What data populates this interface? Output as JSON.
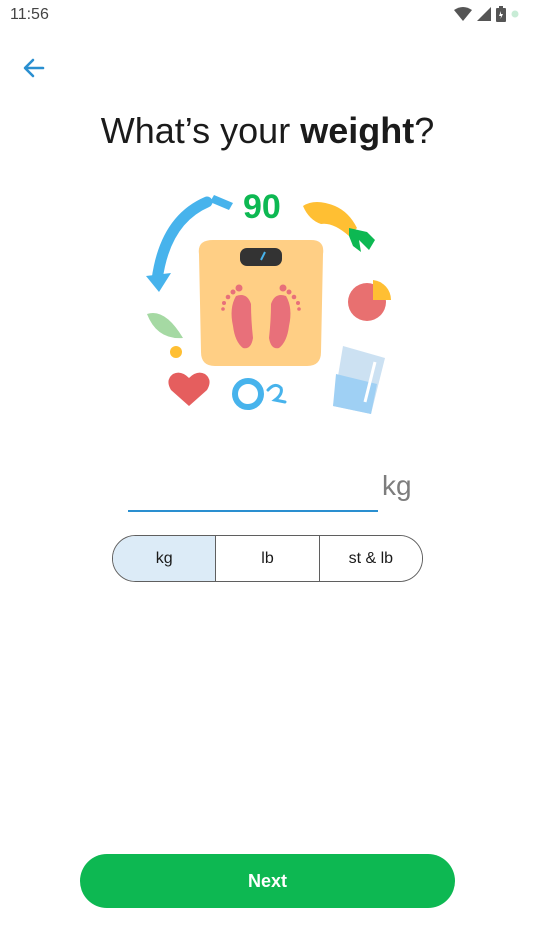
{
  "status_bar": {
    "time": "11:56",
    "icons": [
      "wifi-icon",
      "signal-icon",
      "battery-icon",
      "notification-dot-icon"
    ]
  },
  "header": {
    "back_icon": "arrow-left-icon",
    "accent_color": "#2a8fd0"
  },
  "title": {
    "prefix": "What’s your ",
    "bold": "weight",
    "suffix": "?"
  },
  "illustration": {
    "number": "90",
    "o2_label": "O",
    "o2_sub": "2"
  },
  "weight_input": {
    "value": "",
    "placeholder": "",
    "unit_suffix": "kg"
  },
  "unit_toggle": {
    "options": [
      "kg",
      "lb",
      "st & lb"
    ],
    "selected": "kg"
  },
  "next_button": {
    "label": "Next",
    "color": "#0db852"
  }
}
